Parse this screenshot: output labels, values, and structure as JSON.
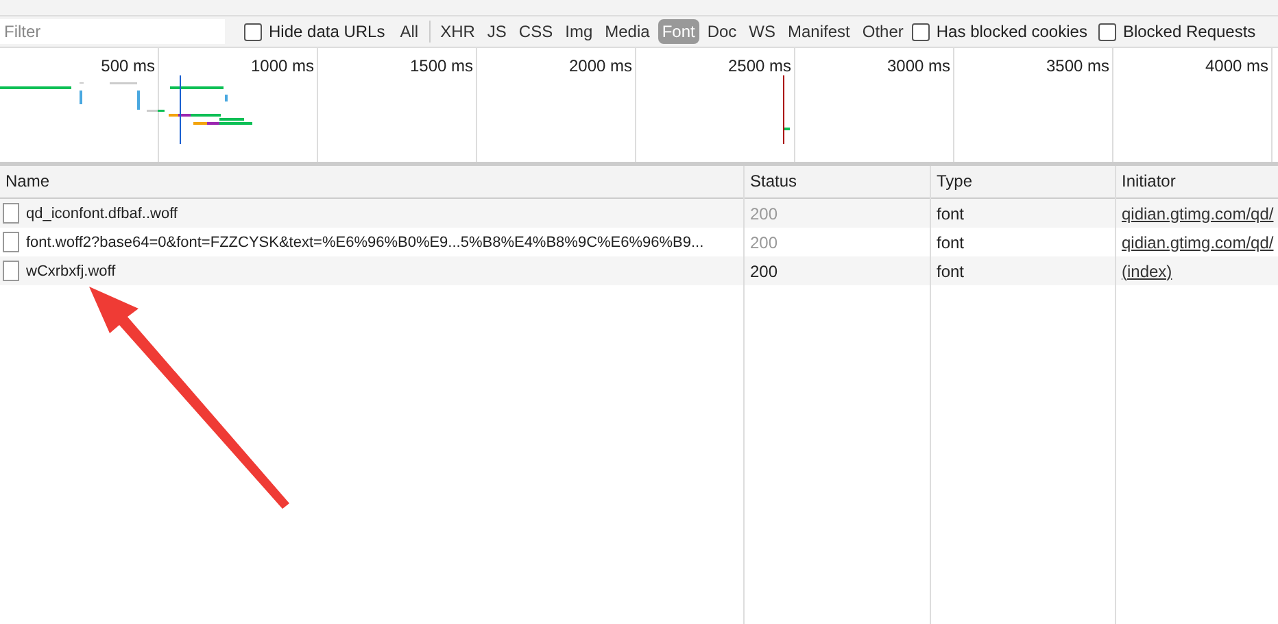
{
  "filter_bar": {
    "placeholder": "Filter",
    "hide_data_urls": {
      "label": "Hide data URLs",
      "checked": false
    },
    "types": [
      {
        "label": "All",
        "selected": false
      },
      {
        "label": "XHR",
        "selected": false
      },
      {
        "label": "JS",
        "selected": false
      },
      {
        "label": "CSS",
        "selected": false
      },
      {
        "label": "Img",
        "selected": false
      },
      {
        "label": "Media",
        "selected": false
      },
      {
        "label": "Font",
        "selected": true
      },
      {
        "label": "Doc",
        "selected": false
      },
      {
        "label": "WS",
        "selected": false
      },
      {
        "label": "Manifest",
        "selected": false
      },
      {
        "label": "Other",
        "selected": false
      }
    ],
    "options": [
      {
        "label": "Has blocked cookies",
        "checked": false
      },
      {
        "label": "Blocked Requests",
        "checked": false
      }
    ]
  },
  "timeline": {
    "ticks": [
      "500 ms",
      "1000 ms",
      "1500 ms",
      "2000 ms",
      "2500 ms",
      "3000 ms",
      "3500 ms",
      "4000 ms"
    ]
  },
  "table": {
    "columns": [
      "Name",
      "Status",
      "Type",
      "Initiator"
    ],
    "rows": [
      {
        "name": "qd_iconfont.dfbaf..woff",
        "status": "200",
        "status_dimmed": true,
        "type": "font",
        "initiator": "qidian.gtimg.com/qd/"
      },
      {
        "name": "font.woff2?base64=0&font=FZZCYSK&text=%E6%96%B0%E9...5%B8%E4%B8%9C%E6%96%B9...",
        "status": "200",
        "status_dimmed": true,
        "type": "font",
        "initiator": "qidian.gtimg.com/qd/"
      },
      {
        "name": "wCxrbxfj.woff",
        "status": "200",
        "status_dimmed": false,
        "type": "font",
        "initiator": "(index)"
      }
    ]
  }
}
